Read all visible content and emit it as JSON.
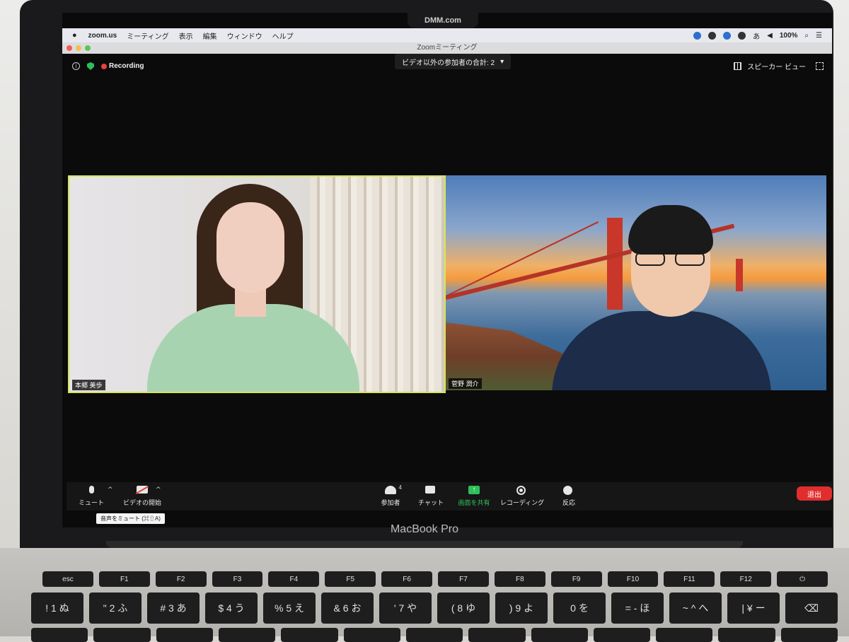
{
  "macos": {
    "menubar": {
      "apple": "",
      "app": "zoom.us",
      "menus": [
        "ミーティング",
        "表示",
        "編集",
        "ウィンドウ",
        "ヘルプ"
      ],
      "input_method": "あ",
      "battery": "100%"
    },
    "camera_brand": "DMM.com",
    "window_title": "Zoomミーティング"
  },
  "zoom": {
    "recording_label": "Recording",
    "participant_count_label": "ビデオ以外の参加者の合計: 2",
    "view_label": "スピーカー ビュー",
    "participants": [
      {
        "name": "本郷 美歩"
      },
      {
        "name": "菅野 潤介"
      }
    ],
    "tooltip": "音声をミュート (⌘⇧A)",
    "toolbar": {
      "mute": "ミュート",
      "video": "ビデオの開始",
      "participants": "参加者",
      "participants_count": "4",
      "chat": "チャット",
      "share": "画面を共有",
      "recording": "レコーディング",
      "reactions": "反応",
      "leave": "退出"
    }
  },
  "laptop": {
    "brand": "MacBook Pro",
    "fn_keys": [
      "esc",
      "F1",
      "F2",
      "F3",
      "F4",
      "F5",
      "F6",
      "F7",
      "F8",
      "F9",
      "F10",
      "F11",
      "F12",
      "⏻"
    ],
    "number_keys": [
      "! 1 ぬ",
      "\" 2 ふ",
      "# 3 あ",
      "$ 4 う",
      "% 5 え",
      "& 6 お",
      "' 7 や",
      "( 8 ゆ",
      ") 9 よ",
      "0 を",
      "= - ほ",
      "~ ^ へ",
      "| ¥ ー",
      "⌫"
    ]
  },
  "colors": {
    "active_speaker_border": "#d7e556",
    "recording_dot": "#e8403a",
    "share_green": "#2fc05a",
    "leave_red": "#e02e2e"
  }
}
